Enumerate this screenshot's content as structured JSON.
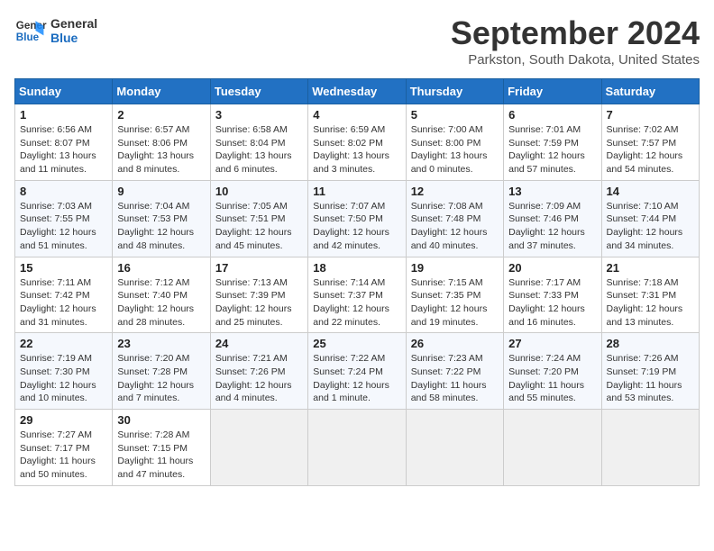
{
  "header": {
    "logo_line1": "General",
    "logo_line2": "Blue",
    "month_title": "September 2024",
    "location": "Parkston, South Dakota, United States"
  },
  "weekdays": [
    "Sunday",
    "Monday",
    "Tuesday",
    "Wednesday",
    "Thursday",
    "Friday",
    "Saturday"
  ],
  "weeks": [
    [
      {
        "day": "1",
        "info": "Sunrise: 6:56 AM\nSunset: 8:07 PM\nDaylight: 13 hours\nand 11 minutes."
      },
      {
        "day": "2",
        "info": "Sunrise: 6:57 AM\nSunset: 8:06 PM\nDaylight: 13 hours\nand 8 minutes."
      },
      {
        "day": "3",
        "info": "Sunrise: 6:58 AM\nSunset: 8:04 PM\nDaylight: 13 hours\nand 6 minutes."
      },
      {
        "day": "4",
        "info": "Sunrise: 6:59 AM\nSunset: 8:02 PM\nDaylight: 13 hours\nand 3 minutes."
      },
      {
        "day": "5",
        "info": "Sunrise: 7:00 AM\nSunset: 8:00 PM\nDaylight: 13 hours\nand 0 minutes."
      },
      {
        "day": "6",
        "info": "Sunrise: 7:01 AM\nSunset: 7:59 PM\nDaylight: 12 hours\nand 57 minutes."
      },
      {
        "day": "7",
        "info": "Sunrise: 7:02 AM\nSunset: 7:57 PM\nDaylight: 12 hours\nand 54 minutes."
      }
    ],
    [
      {
        "day": "8",
        "info": "Sunrise: 7:03 AM\nSunset: 7:55 PM\nDaylight: 12 hours\nand 51 minutes."
      },
      {
        "day": "9",
        "info": "Sunrise: 7:04 AM\nSunset: 7:53 PM\nDaylight: 12 hours\nand 48 minutes."
      },
      {
        "day": "10",
        "info": "Sunrise: 7:05 AM\nSunset: 7:51 PM\nDaylight: 12 hours\nand 45 minutes."
      },
      {
        "day": "11",
        "info": "Sunrise: 7:07 AM\nSunset: 7:50 PM\nDaylight: 12 hours\nand 42 minutes."
      },
      {
        "day": "12",
        "info": "Sunrise: 7:08 AM\nSunset: 7:48 PM\nDaylight: 12 hours\nand 40 minutes."
      },
      {
        "day": "13",
        "info": "Sunrise: 7:09 AM\nSunset: 7:46 PM\nDaylight: 12 hours\nand 37 minutes."
      },
      {
        "day": "14",
        "info": "Sunrise: 7:10 AM\nSunset: 7:44 PM\nDaylight: 12 hours\nand 34 minutes."
      }
    ],
    [
      {
        "day": "15",
        "info": "Sunrise: 7:11 AM\nSunset: 7:42 PM\nDaylight: 12 hours\nand 31 minutes."
      },
      {
        "day": "16",
        "info": "Sunrise: 7:12 AM\nSunset: 7:40 PM\nDaylight: 12 hours\nand 28 minutes."
      },
      {
        "day": "17",
        "info": "Sunrise: 7:13 AM\nSunset: 7:39 PM\nDaylight: 12 hours\nand 25 minutes."
      },
      {
        "day": "18",
        "info": "Sunrise: 7:14 AM\nSunset: 7:37 PM\nDaylight: 12 hours\nand 22 minutes."
      },
      {
        "day": "19",
        "info": "Sunrise: 7:15 AM\nSunset: 7:35 PM\nDaylight: 12 hours\nand 19 minutes."
      },
      {
        "day": "20",
        "info": "Sunrise: 7:17 AM\nSunset: 7:33 PM\nDaylight: 12 hours\nand 16 minutes."
      },
      {
        "day": "21",
        "info": "Sunrise: 7:18 AM\nSunset: 7:31 PM\nDaylight: 12 hours\nand 13 minutes."
      }
    ],
    [
      {
        "day": "22",
        "info": "Sunrise: 7:19 AM\nSunset: 7:30 PM\nDaylight: 12 hours\nand 10 minutes."
      },
      {
        "day": "23",
        "info": "Sunrise: 7:20 AM\nSunset: 7:28 PM\nDaylight: 12 hours\nand 7 minutes."
      },
      {
        "day": "24",
        "info": "Sunrise: 7:21 AM\nSunset: 7:26 PM\nDaylight: 12 hours\nand 4 minutes."
      },
      {
        "day": "25",
        "info": "Sunrise: 7:22 AM\nSunset: 7:24 PM\nDaylight: 12 hours\nand 1 minute."
      },
      {
        "day": "26",
        "info": "Sunrise: 7:23 AM\nSunset: 7:22 PM\nDaylight: 11 hours\nand 58 minutes."
      },
      {
        "day": "27",
        "info": "Sunrise: 7:24 AM\nSunset: 7:20 PM\nDaylight: 11 hours\nand 55 minutes."
      },
      {
        "day": "28",
        "info": "Sunrise: 7:26 AM\nSunset: 7:19 PM\nDaylight: 11 hours\nand 53 minutes."
      }
    ],
    [
      {
        "day": "29",
        "info": "Sunrise: 7:27 AM\nSunset: 7:17 PM\nDaylight: 11 hours\nand 50 minutes."
      },
      {
        "day": "30",
        "info": "Sunrise: 7:28 AM\nSunset: 7:15 PM\nDaylight: 11 hours\nand 47 minutes."
      },
      {
        "day": "",
        "info": ""
      },
      {
        "day": "",
        "info": ""
      },
      {
        "day": "",
        "info": ""
      },
      {
        "day": "",
        "info": ""
      },
      {
        "day": "",
        "info": ""
      }
    ]
  ]
}
